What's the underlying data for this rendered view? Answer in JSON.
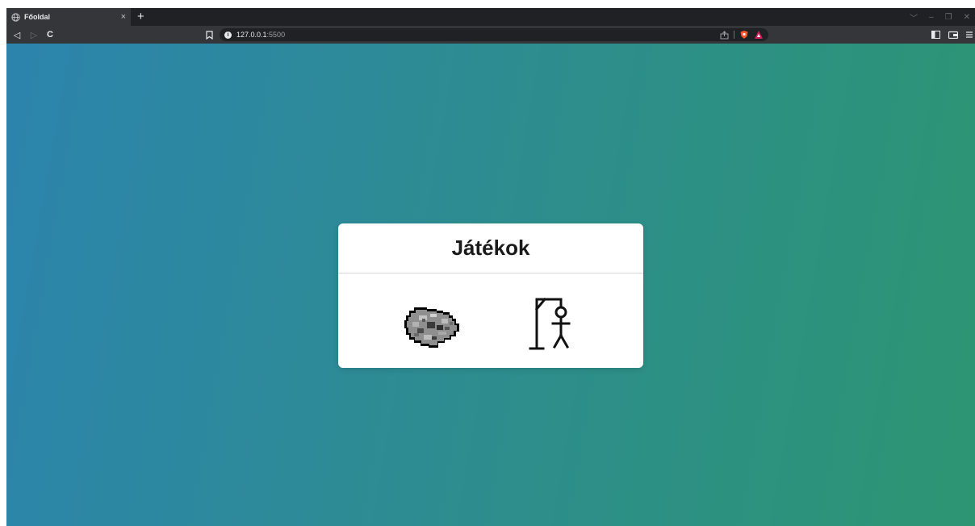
{
  "browser": {
    "tab": {
      "title": "Főoldal",
      "close_glyph": "×",
      "icon": "globe-icon"
    },
    "new_tab_glyph": "+",
    "window_controls": {
      "dropdown": "﹀",
      "minimize": "–",
      "restore": "❐",
      "close": "✕"
    },
    "nav": {
      "back": "◁",
      "forward": "▷",
      "reload": "C"
    },
    "address": {
      "host": "127.0.0.1",
      "port": ":5500"
    }
  },
  "page": {
    "card_title": "Játékok",
    "games": [
      {
        "name": "asteroid",
        "icon": "asteroid-icon"
      },
      {
        "name": "hangman",
        "icon": "hangman-icon"
      }
    ]
  },
  "colors": {
    "gradient_start": "#2c84ad",
    "gradient_end": "#2d9572",
    "card_bg": "#ffffff"
  }
}
